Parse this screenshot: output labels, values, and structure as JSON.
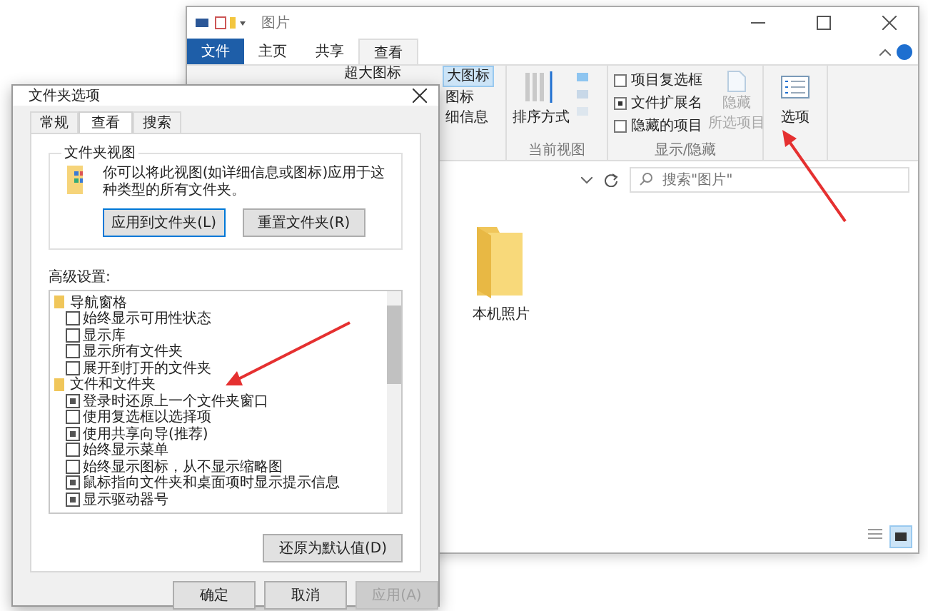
{
  "explorer": {
    "title": "图片",
    "menu_tabs": [
      {
        "label": "文件",
        "kind": "file",
        "selected": false
      },
      {
        "label": "主页",
        "kind": "tab",
        "selected": false
      },
      {
        "label": "共享",
        "kind": "tab",
        "selected": false
      },
      {
        "label": "查看",
        "kind": "tab",
        "selected": true
      }
    ],
    "layout_first_column": [
      {
        "label": "超大图标",
        "selected": false
      }
    ],
    "layout_second_column": [
      {
        "label": "大图标",
        "selected": true
      },
      {
        "label": "图标",
        "selected": false
      },
      {
        "label": "细信息",
        "selected": false
      }
    ],
    "sort_button": "排序方式",
    "current_view_label": "当前视图",
    "show_hide_checkboxes": [
      {
        "label": "项目复选框",
        "checked": false
      },
      {
        "label": "文件扩展名",
        "checked": true
      },
      {
        "label": "隐藏的项目",
        "checked": false
      }
    ],
    "hide_selected_button": {
      "lines": [
        "隐藏",
        "所选项目"
      ],
      "disabled": true
    },
    "show_hide_label": "显示/隐藏",
    "options_button": "选项",
    "search": {
      "placeholder": "搜索\"图片\""
    },
    "items": [
      {
        "name": "本机照片"
      }
    ]
  },
  "dialog": {
    "title": "文件夹选项",
    "tabs": [
      {
        "label": "常规",
        "selected": false
      },
      {
        "label": "查看",
        "selected": true
      },
      {
        "label": "搜索",
        "selected": false
      }
    ],
    "folder_view": {
      "title": "文件夹视图",
      "text": "你可以将此视图(如详细信息或图标)应用于这种类型的所有文件夹。",
      "buttons": [
        {
          "label": "应用到文件夹(L)",
          "focused": true
        },
        {
          "label": "重置文件夹(R)",
          "focused": false
        }
      ]
    },
    "advanced_label": "高级设置:",
    "tree": [
      {
        "label": "导航窗格",
        "children": [
          {
            "label": "始终显示可用性状态",
            "checked": false
          },
          {
            "label": "显示库",
            "checked": false
          },
          {
            "label": "显示所有文件夹",
            "checked": false
          },
          {
            "label": "展开到打开的文件夹",
            "checked": false
          }
        ]
      },
      {
        "label": "文件和文件夹",
        "children": [
          {
            "label": "登录时还原上一个文件夹窗口",
            "checked": true
          },
          {
            "label": "使用复选框以选择项",
            "checked": false
          },
          {
            "label": "使用共享向导(推荐)",
            "checked": true
          },
          {
            "label": "始终显示菜单",
            "checked": false
          },
          {
            "label": "始终显示图标，从不显示缩略图",
            "checked": false
          },
          {
            "label": "鼠标指向文件夹和桌面项时显示提示信息",
            "checked": true
          },
          {
            "label": "显示驱动器号",
            "checked": true
          }
        ]
      }
    ],
    "restore_button": "还原为默认值(D)",
    "footer_buttons": [
      {
        "label": "确定",
        "disabled": false
      },
      {
        "label": "取消",
        "disabled": false
      },
      {
        "label": "应用(A)",
        "disabled": true
      }
    ]
  }
}
